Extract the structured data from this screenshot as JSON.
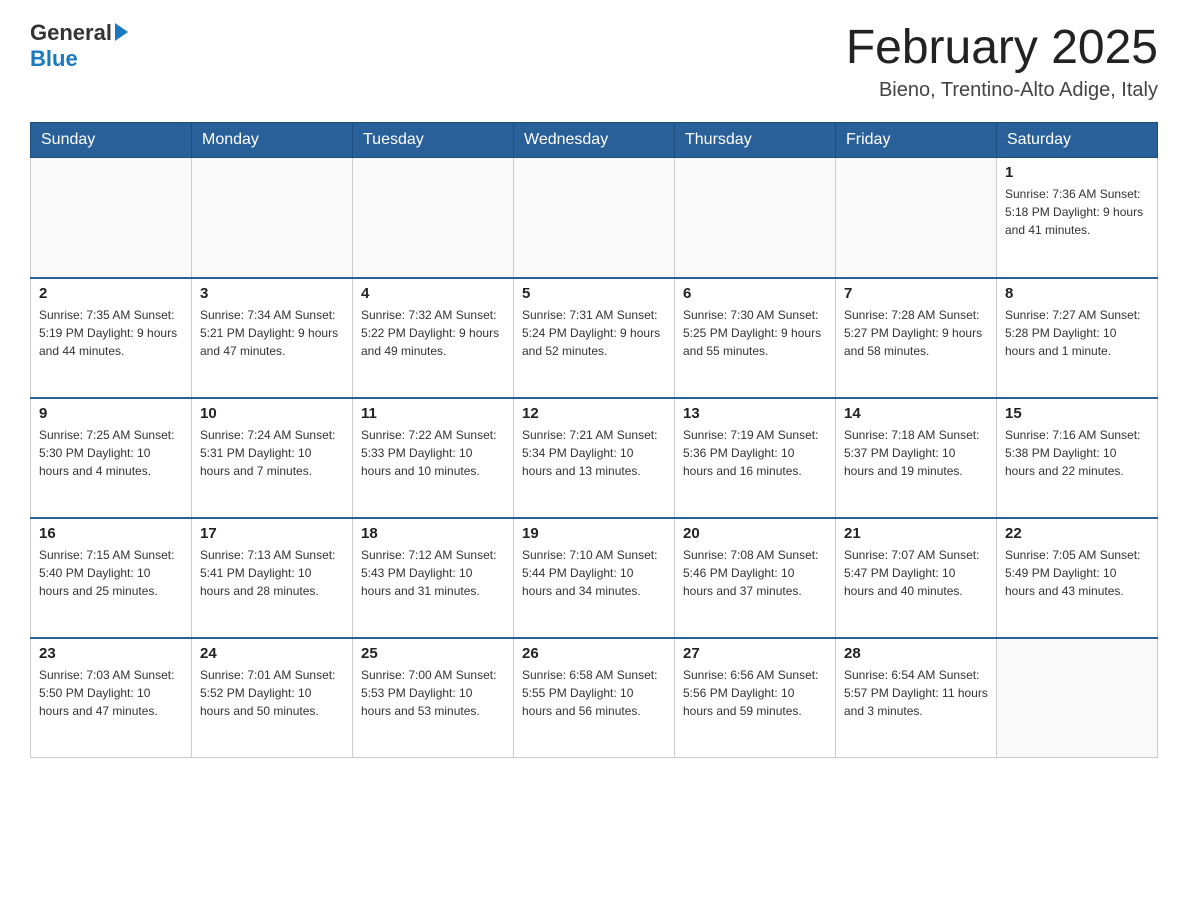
{
  "logo": {
    "text_general": "General",
    "text_blue": "Blue",
    "triangle": "▶"
  },
  "title": "February 2025",
  "subtitle": "Bieno, Trentino-Alto Adige, Italy",
  "days_of_week": [
    "Sunday",
    "Monday",
    "Tuesday",
    "Wednesday",
    "Thursday",
    "Friday",
    "Saturday"
  ],
  "weeks": [
    [
      {
        "day": "",
        "info": ""
      },
      {
        "day": "",
        "info": ""
      },
      {
        "day": "",
        "info": ""
      },
      {
        "day": "",
        "info": ""
      },
      {
        "day": "",
        "info": ""
      },
      {
        "day": "",
        "info": ""
      },
      {
        "day": "1",
        "info": "Sunrise: 7:36 AM\nSunset: 5:18 PM\nDaylight: 9 hours\nand 41 minutes."
      }
    ],
    [
      {
        "day": "2",
        "info": "Sunrise: 7:35 AM\nSunset: 5:19 PM\nDaylight: 9 hours\nand 44 minutes."
      },
      {
        "day": "3",
        "info": "Sunrise: 7:34 AM\nSunset: 5:21 PM\nDaylight: 9 hours\nand 47 minutes."
      },
      {
        "day": "4",
        "info": "Sunrise: 7:32 AM\nSunset: 5:22 PM\nDaylight: 9 hours\nand 49 minutes."
      },
      {
        "day": "5",
        "info": "Sunrise: 7:31 AM\nSunset: 5:24 PM\nDaylight: 9 hours\nand 52 minutes."
      },
      {
        "day": "6",
        "info": "Sunrise: 7:30 AM\nSunset: 5:25 PM\nDaylight: 9 hours\nand 55 minutes."
      },
      {
        "day": "7",
        "info": "Sunrise: 7:28 AM\nSunset: 5:27 PM\nDaylight: 9 hours\nand 58 minutes."
      },
      {
        "day": "8",
        "info": "Sunrise: 7:27 AM\nSunset: 5:28 PM\nDaylight: 10 hours\nand 1 minute."
      }
    ],
    [
      {
        "day": "9",
        "info": "Sunrise: 7:25 AM\nSunset: 5:30 PM\nDaylight: 10 hours\nand 4 minutes."
      },
      {
        "day": "10",
        "info": "Sunrise: 7:24 AM\nSunset: 5:31 PM\nDaylight: 10 hours\nand 7 minutes."
      },
      {
        "day": "11",
        "info": "Sunrise: 7:22 AM\nSunset: 5:33 PM\nDaylight: 10 hours\nand 10 minutes."
      },
      {
        "day": "12",
        "info": "Sunrise: 7:21 AM\nSunset: 5:34 PM\nDaylight: 10 hours\nand 13 minutes."
      },
      {
        "day": "13",
        "info": "Sunrise: 7:19 AM\nSunset: 5:36 PM\nDaylight: 10 hours\nand 16 minutes."
      },
      {
        "day": "14",
        "info": "Sunrise: 7:18 AM\nSunset: 5:37 PM\nDaylight: 10 hours\nand 19 minutes."
      },
      {
        "day": "15",
        "info": "Sunrise: 7:16 AM\nSunset: 5:38 PM\nDaylight: 10 hours\nand 22 minutes."
      }
    ],
    [
      {
        "day": "16",
        "info": "Sunrise: 7:15 AM\nSunset: 5:40 PM\nDaylight: 10 hours\nand 25 minutes."
      },
      {
        "day": "17",
        "info": "Sunrise: 7:13 AM\nSunset: 5:41 PM\nDaylight: 10 hours\nand 28 minutes."
      },
      {
        "day": "18",
        "info": "Sunrise: 7:12 AM\nSunset: 5:43 PM\nDaylight: 10 hours\nand 31 minutes."
      },
      {
        "day": "19",
        "info": "Sunrise: 7:10 AM\nSunset: 5:44 PM\nDaylight: 10 hours\nand 34 minutes."
      },
      {
        "day": "20",
        "info": "Sunrise: 7:08 AM\nSunset: 5:46 PM\nDaylight: 10 hours\nand 37 minutes."
      },
      {
        "day": "21",
        "info": "Sunrise: 7:07 AM\nSunset: 5:47 PM\nDaylight: 10 hours\nand 40 minutes."
      },
      {
        "day": "22",
        "info": "Sunrise: 7:05 AM\nSunset: 5:49 PM\nDaylight: 10 hours\nand 43 minutes."
      }
    ],
    [
      {
        "day": "23",
        "info": "Sunrise: 7:03 AM\nSunset: 5:50 PM\nDaylight: 10 hours\nand 47 minutes."
      },
      {
        "day": "24",
        "info": "Sunrise: 7:01 AM\nSunset: 5:52 PM\nDaylight: 10 hours\nand 50 minutes."
      },
      {
        "day": "25",
        "info": "Sunrise: 7:00 AM\nSunset: 5:53 PM\nDaylight: 10 hours\nand 53 minutes."
      },
      {
        "day": "26",
        "info": "Sunrise: 6:58 AM\nSunset: 5:55 PM\nDaylight: 10 hours\nand 56 minutes."
      },
      {
        "day": "27",
        "info": "Sunrise: 6:56 AM\nSunset: 5:56 PM\nDaylight: 10 hours\nand 59 minutes."
      },
      {
        "day": "28",
        "info": "Sunrise: 6:54 AM\nSunset: 5:57 PM\nDaylight: 11 hours\nand 3 minutes."
      },
      {
        "day": "",
        "info": ""
      }
    ]
  ]
}
